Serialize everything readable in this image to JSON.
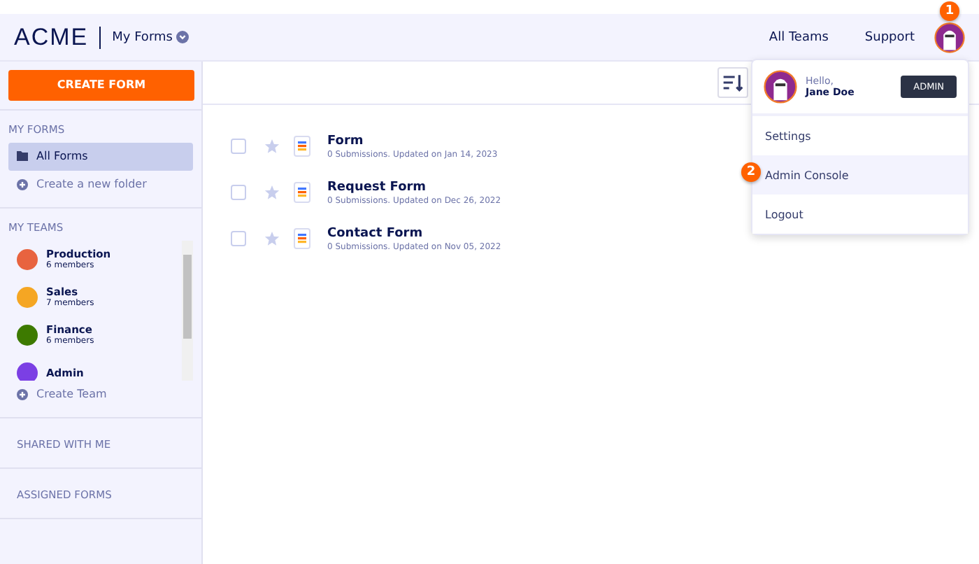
{
  "header": {
    "logo": "ACME",
    "section": "My Forms",
    "links": [
      "All Teams",
      "Support"
    ],
    "step_badge": "1"
  },
  "sidebar": {
    "create_button": "CREATE FORM",
    "my_forms_heading": "MY FORMS",
    "folders": [
      {
        "label": "All Forms",
        "selected": true
      }
    ],
    "create_folder": "Create a new folder",
    "my_teams_heading": "MY TEAMS",
    "teams": [
      {
        "name": "Production",
        "members": "6 members",
        "color": "#e8633f"
      },
      {
        "name": "Sales",
        "members": "7 members",
        "color": "#f5a623"
      },
      {
        "name": "Finance",
        "members": "6 members",
        "color": "#3d7a00"
      },
      {
        "name": "Admin",
        "color": "#7b3fe4"
      }
    ],
    "create_team": "Create Team",
    "sections": [
      "SHARED WITH ME",
      "ASSIGNED FORMS"
    ]
  },
  "forms": [
    {
      "title": "Form",
      "meta": "0 Submissions. Updated on Jan 14, 2023",
      "checked": false,
      "starred": false
    },
    {
      "title": "Request Form",
      "meta": "0 Submissions. Updated on Dec 26, 2022",
      "checked": false,
      "starred": false
    },
    {
      "title": "Contact Form",
      "meta": "0 Submissions. Updated on Nov 05, 2022",
      "checked": false,
      "starred": false
    }
  ],
  "user_menu": {
    "greeting": "Hello,",
    "user_name": "Jane Doe",
    "role_badge": "ADMIN",
    "items": [
      {
        "label": "Settings",
        "selected": false
      },
      {
        "label": "Admin Console",
        "selected": true,
        "step_badge": "2"
      },
      {
        "label": "Logout",
        "selected": false
      }
    ]
  }
}
